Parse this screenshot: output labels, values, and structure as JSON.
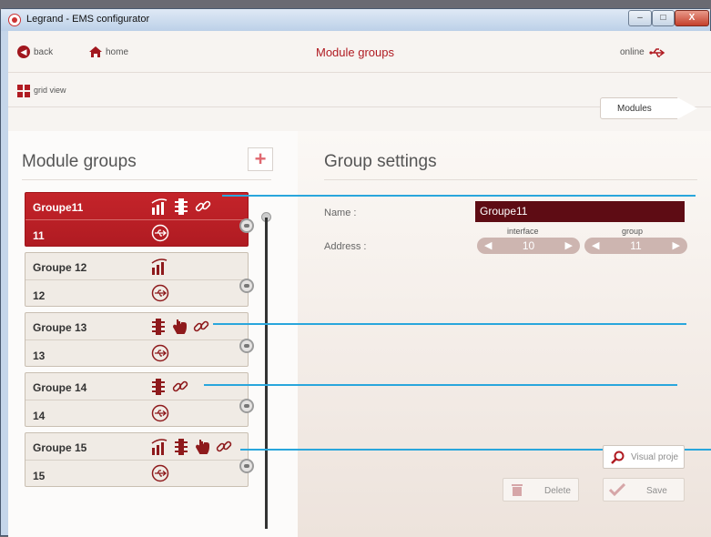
{
  "window": {
    "title": "Legrand - EMS configurator",
    "min": "–",
    "max": "□",
    "close": "X"
  },
  "nav": {
    "back": "back",
    "home": "home",
    "page_title": "Module groups",
    "status": "online",
    "grid_view": "grid view",
    "modules_tab": "Modules"
  },
  "left": {
    "title": "Module groups",
    "add": "+"
  },
  "groups": [
    {
      "name": "Groupe11",
      "address": "11",
      "icons": [
        "chart-icon",
        "traffic-light-icon",
        "link-icon"
      ],
      "selected": true
    },
    {
      "name": "Groupe 12",
      "address": "12",
      "icons": [
        "chart-icon"
      ],
      "selected": false
    },
    {
      "name": "Groupe 13",
      "address": "13",
      "icons": [
        "traffic-light-icon",
        "hand-pointer-icon",
        "link-icon"
      ],
      "selected": false
    },
    {
      "name": "Groupe 14",
      "address": "14",
      "icons": [
        "traffic-light-icon",
        "link-icon"
      ],
      "selected": false
    },
    {
      "name": "Groupe 15",
      "address": "15",
      "icons": [
        "chart-icon",
        "traffic-light-icon",
        "hand-pointer-icon",
        "link-icon"
      ],
      "selected": false
    }
  ],
  "settings": {
    "title": "Group settings",
    "name_label": "Name :",
    "name_value": "Groupe11",
    "address_label": "Address :",
    "interface_label": "interface",
    "interface_value": "10",
    "group_label": "group",
    "group_value": "11",
    "visual_button": "Visual proje",
    "delete_button": "Delete",
    "save_button": "Save"
  },
  "colors": {
    "accent": "#b01b22",
    "line": "#29a6dc"
  }
}
